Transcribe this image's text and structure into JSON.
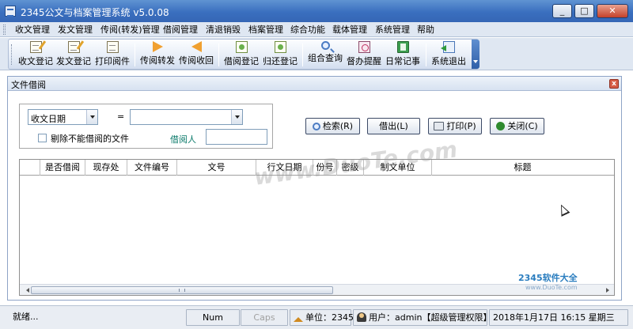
{
  "window": {
    "title": "2345公文与档案管理系统 v5.0.08",
    "controls": [
      "minimize",
      "maximize",
      "close"
    ]
  },
  "menu": [
    "收文管理",
    "发文管理",
    "传阅(转发)管理",
    "借阅管理",
    "清退销毁",
    "档案管理",
    "综合功能",
    "载体管理",
    "系统管理",
    "帮助"
  ],
  "toolbar": [
    {
      "label": "收文登记",
      "icon": "receive-doc-icon"
    },
    {
      "label": "发文登记",
      "icon": "send-doc-icon"
    },
    {
      "label": "打印阅件",
      "icon": "print-doc-icon"
    },
    {
      "label": "传阅转发",
      "icon": "arrow-right-icon"
    },
    {
      "label": "传阅收回",
      "icon": "arrow-left-icon"
    },
    {
      "label": "借阅登记",
      "icon": "borrow-icon"
    },
    {
      "label": "归还登记",
      "icon": "return-icon"
    },
    {
      "label": "组合查询",
      "icon": "search-icon"
    },
    {
      "label": "督办提醒",
      "icon": "reminder-icon"
    },
    {
      "label": "日常记事",
      "icon": "notebook-icon"
    },
    {
      "label": "系统退出",
      "icon": "exit-icon"
    }
  ],
  "child_window": {
    "title": "文件借阅",
    "close_glyph": "x"
  },
  "query": {
    "field_select": "收文日期",
    "operator": "=",
    "value_select": "",
    "exclude_label": "剔除不能借阅的文件",
    "exclude_checked": false,
    "borrower_label": "借阅人",
    "borrower_value": ""
  },
  "buttons": {
    "search": "检索(R)",
    "borrow": "借出(L)",
    "print": "打印(P)",
    "close": "关闭(C)"
  },
  "table": {
    "columns": [
      "",
      "是否借阅",
      "现存处",
      "文件编号",
      "文号",
      "行文日期",
      "份号",
      "密级",
      "制文单位",
      "标题"
    ],
    "rows": []
  },
  "overlay": {
    "watermark": "www.DuoTe.com",
    "logo_text": "2345软件大全",
    "logo_url": "www.DuoTe.com"
  },
  "status": {
    "ready": "就绪...",
    "num": "Num",
    "caps": "Caps",
    "unit": "单位：2345",
    "user": "用户：admin【超级管理权限】",
    "datetime": "2018年1月17日  16:15  星期三"
  }
}
